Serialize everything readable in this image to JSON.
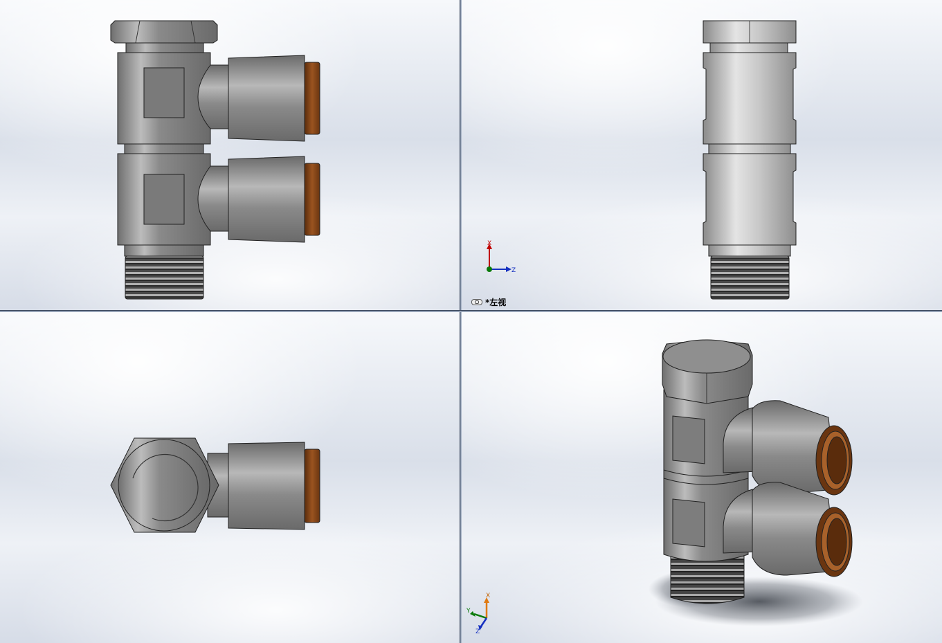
{
  "viewports": {
    "front": {
      "label": ""
    },
    "left": {
      "label": "*左视",
      "triad_axes": [
        "X",
        "Z"
      ]
    },
    "top": {
      "label": ""
    },
    "isometric": {
      "label": "",
      "triad_axes": [
        "X",
        "Y",
        "Z"
      ]
    }
  },
  "colors": {
    "metal": "#9a9a9a",
    "metal_dark": "#5e5e5e",
    "copper": "#8a4a1a",
    "axis_x": "#c00000",
    "axis_y": "#0a7a0a",
    "axis_z": "#1530c0"
  },
  "icons": {
    "view_link": "link-icon",
    "triad": "coordinate-triad-icon"
  }
}
